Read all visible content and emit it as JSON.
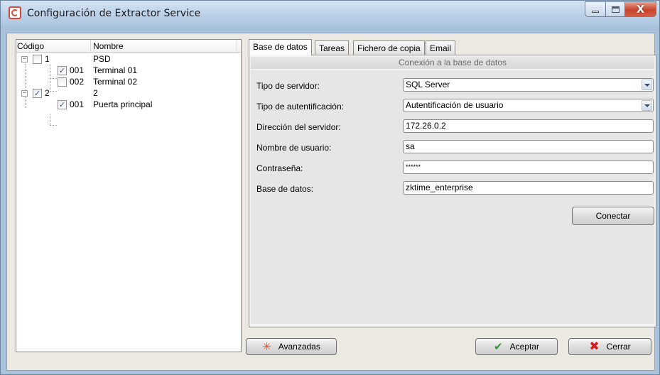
{
  "window": {
    "title": "Configuración de Extractor Service",
    "controls": {
      "minimize_icon": "minimize-icon",
      "maximize_icon": "maximize-icon",
      "close_glyph": "X"
    }
  },
  "tree": {
    "headers": {
      "code": "Código",
      "name": "Nombre"
    },
    "rows": [
      {
        "code": "1",
        "name": "PSD",
        "checked": false,
        "expander": "−"
      },
      {
        "code": "001",
        "name": "Terminal 01",
        "checked": true,
        "check_mark": "✓"
      },
      {
        "code": "002",
        "name": "Terminal 02",
        "checked": false,
        "check_mark": ""
      },
      {
        "code": "2",
        "name": "2",
        "checked": true,
        "expander": "−",
        "check_mark": "✓"
      },
      {
        "code": "001",
        "name": "Puerta principal",
        "checked": true,
        "check_mark": "✓"
      }
    ]
  },
  "tabs": [
    {
      "label": "Base de datos",
      "active": true
    },
    {
      "label": "Tareas",
      "active": false
    },
    {
      "label": "Fichero de copia",
      "active": false
    },
    {
      "label": "Email",
      "active": false
    }
  ],
  "database": {
    "group_title": "Conexión a la base de datos",
    "fields": [
      {
        "label": "Tipo de servidor:",
        "value": "SQL Server",
        "type": "combo"
      },
      {
        "label": "Tipo de autentificación:",
        "value": "Autentificación de usuario",
        "type": "combo"
      },
      {
        "label": "Dirección del servidor:",
        "value": "172.26.0.2",
        "type": "text"
      },
      {
        "label": "Nombre de usuario:",
        "value": "sa",
        "type": "text"
      },
      {
        "label": "Contraseña:",
        "value": "******",
        "type": "password"
      },
      {
        "label": "Base de datos:",
        "value": "zktime_enterprise",
        "type": "text"
      }
    ],
    "connect_label": "Conectar"
  },
  "footer": {
    "advanced_label": "Avanzadas",
    "accept_label": "Aceptar",
    "close_label": "Cerrar",
    "advanced_icon_glyph": "✳",
    "accept_icon_glyph": "✔",
    "close_icon_glyph": "✖"
  }
}
